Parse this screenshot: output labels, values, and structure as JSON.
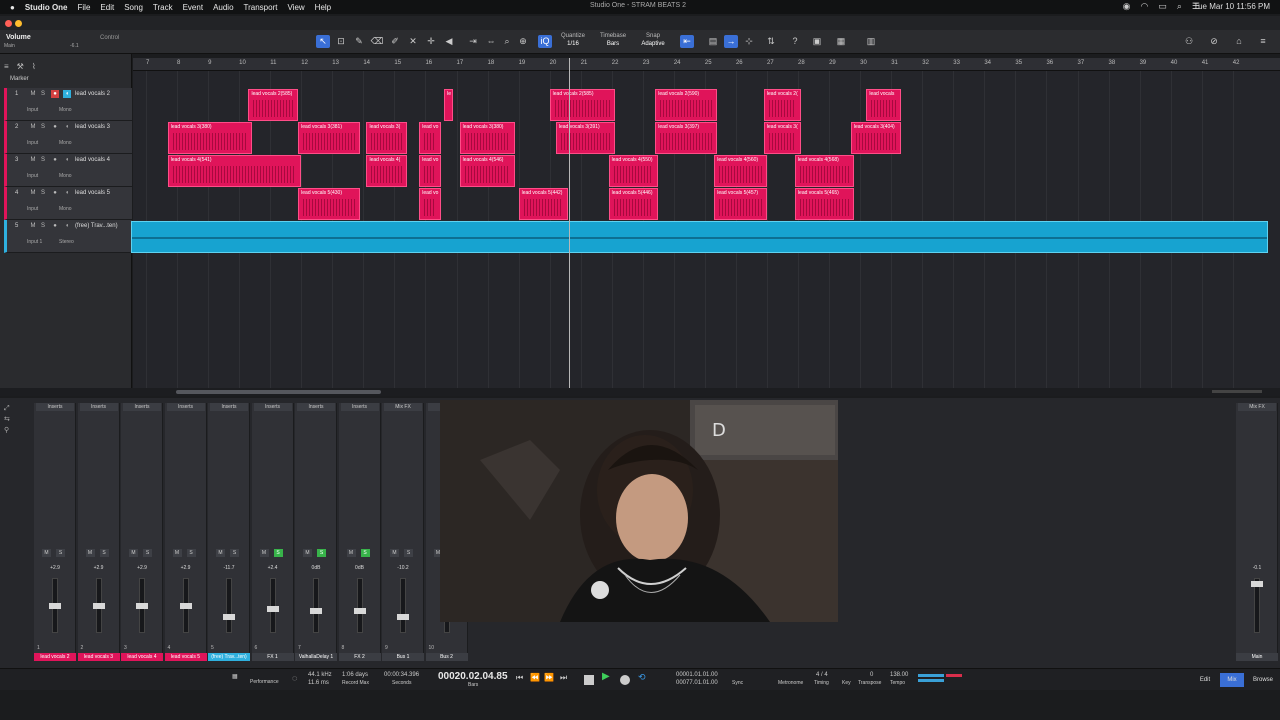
{
  "menubar": {
    "app": "Studio One",
    "items": [
      "File",
      "Edit",
      "Song",
      "Track",
      "Event",
      "Audio",
      "Transport",
      "View",
      "Help"
    ],
    "window_title": "Studio One - STRAM BEATS 2",
    "clock": "Tue Mar 10  11:56 PM"
  },
  "toolbar": {
    "param": "Volume",
    "param_sub": "Main",
    "param_val": "-6.1",
    "control": "Control",
    "quantize_label": "Quantize",
    "quantize_val": "1/16",
    "timebase_label": "Timebase",
    "timebase_val": "Bars",
    "snap_label": "Snap",
    "snap_val": "Adaptive",
    "marker": "Marker"
  },
  "ruler": [
    "7",
    "8",
    "9",
    "10",
    "11",
    "12",
    "13",
    "14",
    "15",
    "16",
    "17",
    "18",
    "19",
    "20",
    "21",
    "22",
    "23",
    "24",
    "25",
    "26",
    "27",
    "28",
    "29",
    "30",
    "31",
    "32",
    "33",
    "34",
    "35",
    "36",
    "37",
    "38",
    "39",
    "40",
    "41",
    "42"
  ],
  "tracks": [
    {
      "num": "1",
      "name": "lead vocals 2",
      "input": "Input",
      "mode": "Mono"
    },
    {
      "num": "2",
      "name": "lead vocals 3",
      "input": "Input",
      "mode": "Mono"
    },
    {
      "num": "3",
      "name": "lead vocals 4",
      "input": "Input",
      "mode": "Mono"
    },
    {
      "num": "4",
      "name": "lead vocals 5",
      "input": "Input",
      "mode": "Mono"
    },
    {
      "num": "5",
      "name": "(free) Trav...ten)",
      "input": "Input 1",
      "mode": "Stereo"
    }
  ],
  "clips": [
    {
      "row": 0,
      "bar": 10.3,
      "len": 1.6,
      "label": "lead vocals 2(585)"
    },
    {
      "row": 0,
      "bar": 16.6,
      "len": 0.3,
      "label": "le"
    },
    {
      "row": 0,
      "bar": 20.0,
      "len": 2.1,
      "label": "lead vocals 2(585)"
    },
    {
      "row": 0,
      "bar": 23.4,
      "len": 2.0,
      "label": "lead vocals 2(590)"
    },
    {
      "row": 0,
      "bar": 26.9,
      "len": 1.2,
      "label": "lead vocals 2("
    },
    {
      "row": 0,
      "bar": 30.2,
      "len": 1.1,
      "label": "lead vocals"
    },
    {
      "row": 1,
      "bar": 7.7,
      "len": 2.7,
      "label": "lead vocals 3(380)"
    },
    {
      "row": 1,
      "bar": 11.9,
      "len": 2.0,
      "label": "lead vocals 3(381)"
    },
    {
      "row": 1,
      "bar": 14.1,
      "len": 1.3,
      "label": "lead vocals 3("
    },
    {
      "row": 1,
      "bar": 15.8,
      "len": 0.7,
      "label": "lead vo"
    },
    {
      "row": 1,
      "bar": 17.1,
      "len": 1.8,
      "label": "lead vocals 3(380)"
    },
    {
      "row": 1,
      "bar": 20.2,
      "len": 1.9,
      "label": "lead vocals 3(391)"
    },
    {
      "row": 1,
      "bar": 23.4,
      "len": 2.0,
      "label": "lead vocals 3(397)"
    },
    {
      "row": 1,
      "bar": 26.9,
      "len": 1.2,
      "label": "lead vocals 3("
    },
    {
      "row": 1,
      "bar": 29.7,
      "len": 1.6,
      "label": "lead vocals 3(404)"
    },
    {
      "row": 2,
      "bar": 7.7,
      "len": 4.3,
      "label": "lead vocals 4(541)"
    },
    {
      "row": 2,
      "bar": 14.1,
      "len": 1.3,
      "label": "lead vocals 4("
    },
    {
      "row": 2,
      "bar": 15.8,
      "len": 0.7,
      "label": "lead vo"
    },
    {
      "row": 2,
      "bar": 17.1,
      "len": 1.8,
      "label": "lead vocals 4(546)"
    },
    {
      "row": 2,
      "bar": 21.9,
      "len": 1.6,
      "label": "lead vocals 4(550)"
    },
    {
      "row": 2,
      "bar": 25.3,
      "len": 1.7,
      "label": "lead vocals 4(560)"
    },
    {
      "row": 2,
      "bar": 27.9,
      "len": 1.9,
      "label": "lead vocals 4(568)"
    },
    {
      "row": 3,
      "bar": 11.9,
      "len": 2.0,
      "label": "lead vocals 5(430)"
    },
    {
      "row": 3,
      "bar": 15.8,
      "len": 0.7,
      "label": "lead vo"
    },
    {
      "row": 3,
      "bar": 19.0,
      "len": 1.6,
      "label": "lead vocals 5(442)"
    },
    {
      "row": 3,
      "bar": 21.9,
      "len": 1.6,
      "label": "lead vocals 5(446)"
    },
    {
      "row": 3,
      "bar": 25.3,
      "len": 1.7,
      "label": "lead vocals 5(457)"
    },
    {
      "row": 3,
      "bar": 27.9,
      "len": 1.9,
      "label": "lead vocals 5(465)"
    }
  ],
  "mixer": {
    "strips": [
      {
        "name": "lead vocals 2",
        "val": "+2.9",
        "ins": "Inserts",
        "num": "1"
      },
      {
        "name": "lead vocals 3",
        "val": "+2.9",
        "ins": "Inserts",
        "num": "2"
      },
      {
        "name": "lead vocals 4",
        "val": "+2.9",
        "ins": "Inserts",
        "num": "3"
      },
      {
        "name": "lead vocals 5",
        "val": "+2.9",
        "ins": "Inserts",
        "num": "4"
      },
      {
        "name": "(free) Trav...ten)",
        "val": "-11.7",
        "ins": "Inserts",
        "num": "5"
      },
      {
        "name": "FX 1",
        "val": "+2.4",
        "ins": "Inserts",
        "num": "6"
      },
      {
        "name": "ValhallaDelay 1",
        "val": "0dB",
        "ins": "Inserts",
        "num": "7"
      },
      {
        "name": "FX 2",
        "val": "0dB",
        "ins": "Inserts",
        "num": "8"
      },
      {
        "name": "Bus 1",
        "val": "-10.2",
        "ins": "Mix FX",
        "num": "9"
      },
      {
        "name": "Bus 2",
        "val": "",
        "ins": "",
        "num": "10"
      }
    ],
    "main_name": "Main",
    "main_val": "-0.1",
    "main_fx": "Mix FX"
  },
  "transport": {
    "rate": "44.1 kHz",
    "latency": "11.6 ms",
    "days": "1:06 days",
    "record_max": "Record Max",
    "seconds": "00:00:34.396",
    "seconds_label": "Seconds",
    "position": "00020.02.04.85",
    "bars_label": "Bars",
    "loop_start": "00001.01.01.00",
    "loop_end": "00077.01.01.00",
    "sig": "4 / 4",
    "timing": "Timing",
    "key": "Key",
    "transpose": "0",
    "transpose_label": "Transpose",
    "tempo": "138.00",
    "tempo_label": "Tempo",
    "metronome": "Metronome",
    "sync": "Sync",
    "performance": "Performance",
    "edit_tab": "Edit",
    "mix_tab": "Mix",
    "browse_tab": "Browse"
  }
}
